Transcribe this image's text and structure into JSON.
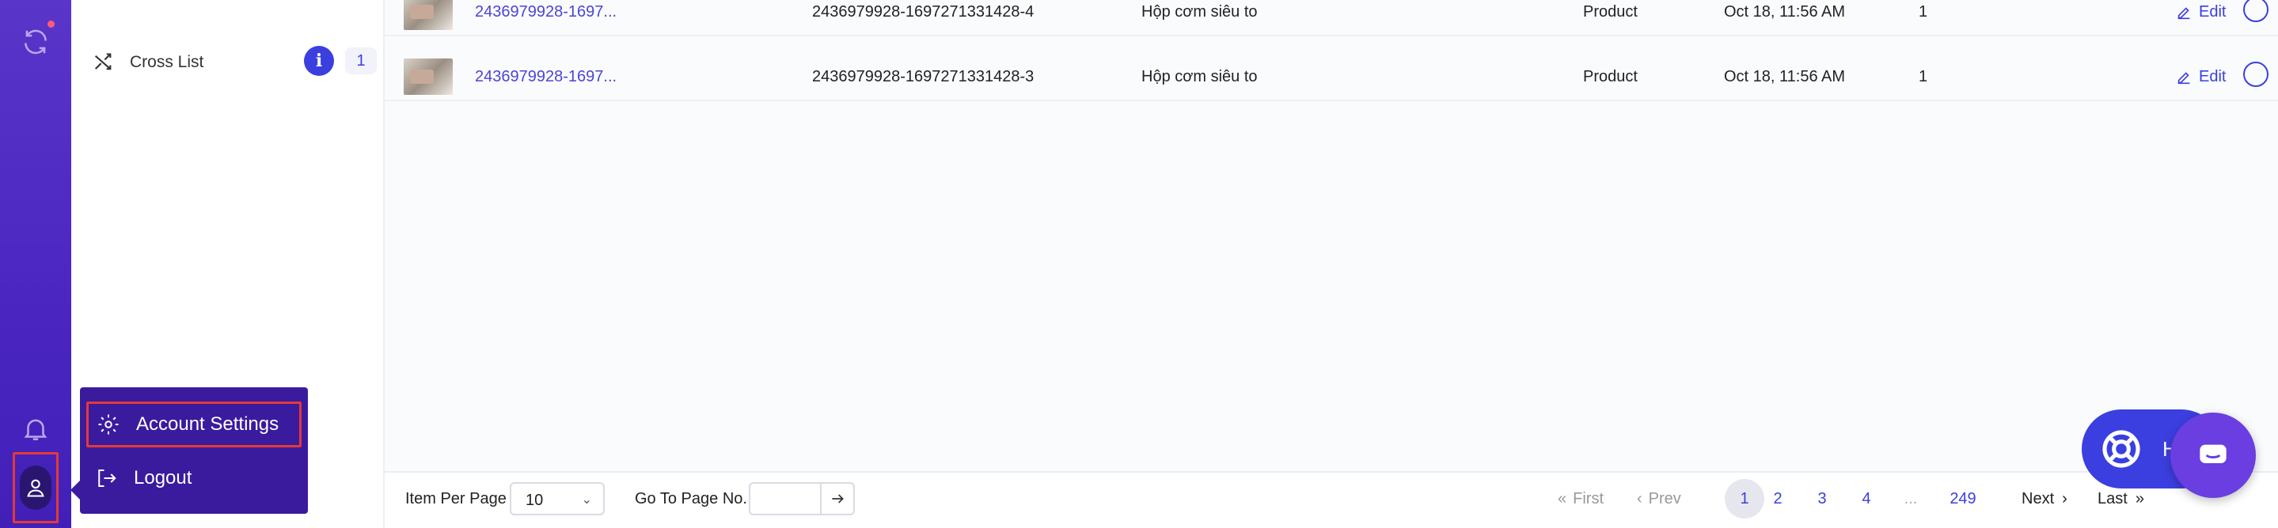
{
  "sidebar": {
    "cross_list": {
      "label": "Cross List",
      "info": "i",
      "count": "1"
    }
  },
  "account_menu": {
    "account_settings": "Account Settings",
    "logout": "Logout"
  },
  "rows": [
    {
      "title": "2436979928-1697...",
      "sku": "2436979928-1697271331428-4",
      "name": "Hộp cơm siêu to",
      "type": "Product",
      "date": "Oct 18, 11:56 AM",
      "qty": "1",
      "edit": "Edit"
    },
    {
      "title": "2436979928-1697...",
      "sku": "2436979928-1697271331428-3",
      "name": "Hộp cơm siêu to",
      "type": "Product",
      "date": "Oct 18, 11:56 AM",
      "qty": "1",
      "edit": "Edit"
    }
  ],
  "footer": {
    "item_per_page_label": "Item Per Page",
    "item_per_page_value": "10",
    "go_to_page_label": "Go To Page No.",
    "first": "First",
    "prev": "Prev",
    "pages": [
      "1",
      "2",
      "3",
      "4",
      "...",
      "249"
    ],
    "next": "Next",
    "last": "Last"
  },
  "help": {
    "label": "He"
  },
  "colors": {
    "accent": "#3b3fe0",
    "rail": "#4a25c0",
    "popup": "#3a1b9e",
    "highlight": "#e53935"
  }
}
